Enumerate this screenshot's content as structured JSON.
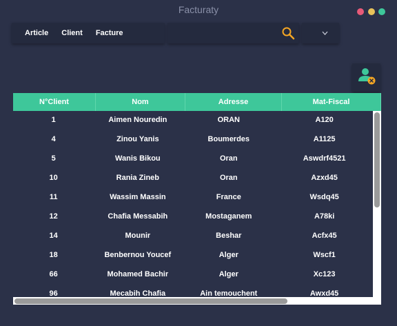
{
  "window": {
    "title": "Facturaty"
  },
  "menu": {
    "items": [
      "Article",
      "Client",
      "Facture"
    ]
  },
  "search": {
    "value": "",
    "placeholder": ""
  },
  "table": {
    "columns": [
      "N°Client",
      "Nom",
      "Adresse",
      "Mat-Fiscal"
    ],
    "rows": [
      [
        "1",
        "Aimen Nouredin",
        "ORAN",
        "A120"
      ],
      [
        "4",
        "Zinou Yanis",
        "Boumerdes",
        "A1125"
      ],
      [
        "5",
        "Wanis Bikou",
        "Oran",
        "Aswdrf4521"
      ],
      [
        "10",
        "Rania Zineb",
        "Oran",
        "Azxd45"
      ],
      [
        "11",
        "Wassim Massin",
        "France",
        "Wsdq45"
      ],
      [
        "12",
        "Chafia Messabih",
        "Mostaganem",
        "A78ki"
      ],
      [
        "14",
        "Mounir",
        "Beshar",
        "Acfx45"
      ],
      [
        "18",
        "Benbernou Youcef",
        "Alger",
        "Wscf1"
      ],
      [
        "66",
        "Mohamed Bachir",
        "Alger",
        "Xc123"
      ],
      [
        "96",
        "Mecabih Chafia",
        "Ain temouchent",
        "Awxd45"
      ]
    ]
  },
  "colors": {
    "background": "#2b3148",
    "accent": "#3ec79a",
    "panel": "#242a3e",
    "search_icon": "#f5a623"
  },
  "icons": {
    "search": "search-icon",
    "dropdown": "chevron-down-icon",
    "user": "user-remove-icon"
  }
}
